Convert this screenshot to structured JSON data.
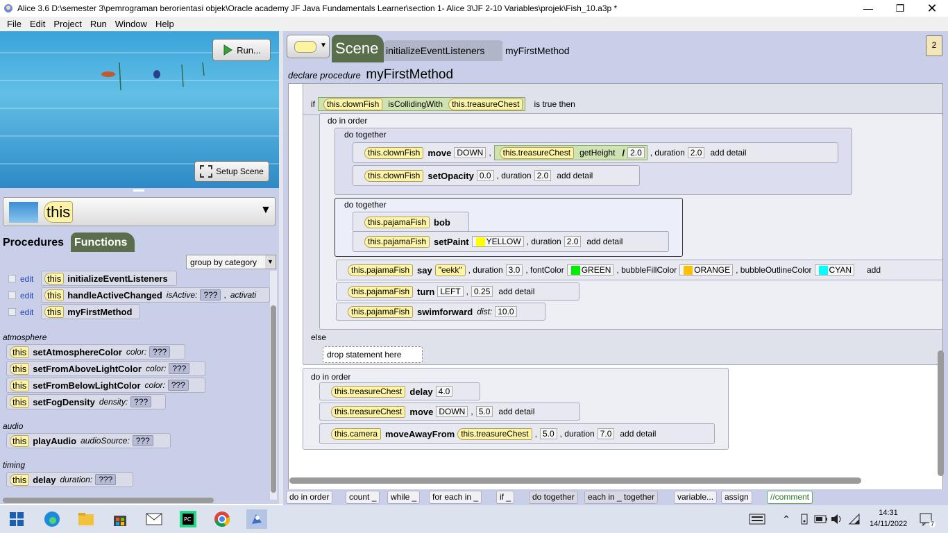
{
  "window": {
    "title": "Alice 3.6 D:\\semester 3\\pemrograman berorientasi objek\\Oracle academy JF Java Fundamentals Learner\\section 1- Alice 3\\JF 2-10 Variables\\projek\\Fish_10.a3p *"
  },
  "menu": [
    "File",
    "Edit",
    "Project",
    "Run",
    "Window",
    "Help"
  ],
  "scene": {
    "run_label": "Run...",
    "setup_label": "Setup Scene"
  },
  "selector": {
    "value": "this"
  },
  "panel_tabs": {
    "procedures": "Procedures",
    "functions": "Functions"
  },
  "group_by": "group by category",
  "methods": [
    {
      "edit": "edit",
      "this": "this",
      "name": "initializeEventListeners",
      "param": "",
      "value": ""
    },
    {
      "edit": "edit",
      "this": "this",
      "name": "handleActiveChanged",
      "param": "isActive:",
      "value": "???",
      "extra": "activati"
    },
    {
      "edit": "edit",
      "this": "this",
      "name": "myFirstMethod",
      "param": "",
      "value": ""
    }
  ],
  "categories": [
    {
      "name": "atmosphere",
      "items": [
        {
          "this": "this",
          "name": "setAtmosphereColor",
          "param": "color:",
          "value": "???"
        },
        {
          "this": "this",
          "name": "setFromAboveLightColor",
          "param": "color:",
          "value": "???"
        },
        {
          "this": "this",
          "name": "setFromBelowLightColor",
          "param": "color:",
          "value": "???"
        },
        {
          "this": "this",
          "name": "setFogDensity",
          "param": "density:",
          "value": "???"
        }
      ]
    },
    {
      "name": "audio",
      "items": [
        {
          "this": "this",
          "name": "playAudio",
          "param": "audioSource:",
          "value": "???"
        }
      ]
    },
    {
      "name": "timing",
      "items": [
        {
          "this": "this",
          "name": "delay",
          "param": "duration:",
          "value": "???"
        }
      ]
    }
  ],
  "editor_tabs": {
    "scene": "Scene",
    "init": "initializeEventListeners",
    "current": "myFirstMethod",
    "clip_count": "2"
  },
  "declare": {
    "prefix": "declare procedure",
    "name": "myFirstMethod"
  },
  "code": {
    "if_kw": "if",
    "clownfish": "this.clownFish",
    "colliding": "isCollidingWith",
    "chest": "this.treasureChest",
    "is_true": "is true then",
    "do_in_order": "do in order",
    "do_together": "do together",
    "move": "move",
    "down": "DOWN",
    "getheight": "getHeight",
    "div": "/",
    "v2": "2.0",
    "duration": ", duration",
    "add_detail": "add detail",
    "setopacity": "setOpacity",
    "v0": "0.0",
    "pajama": "this.pajamaFish",
    "bob": "bob",
    "setpaint": "setPaint",
    "yellow": "YELLOW",
    "say": "say",
    "eekk": "\"eekk\"",
    "v3": "3.0",
    "fontcolor": ", fontColor",
    "green": "GREEN",
    "bubblefill": ", bubbleFillColor",
    "orange": "ORANGE",
    "bubbleoutline": ", bubbleOutlineColor",
    "cyan": "CYAN",
    "add_trunc": "add",
    "turn": "turn",
    "left": "LEFT",
    "v025": "0.25",
    "swim": "swimforward",
    "dist": "dist:",
    "v10": "10.0",
    "else_kw": "else",
    "drop": "drop statement here",
    "delay": "delay",
    "v4": "4.0",
    "v5": "5.0",
    "camera": "this.camera",
    "moveaway": "moveAwayFrom",
    "v7": "7.0"
  },
  "palette": [
    "do in order",
    "count _",
    "while _",
    "for each in _",
    "if _",
    "do together",
    "each in _ together",
    "variable...",
    "assign",
    "//comment"
  ],
  "taskbar": {
    "time": "14:31",
    "date": "14/11/2022",
    "notif": "7"
  },
  "colors": {
    "panel": "#c9cfe8",
    "object_pill": "#fdf4a5",
    "green": "#00ee00",
    "orange": "#ffc000",
    "cyan": "#00ffff",
    "yellow": "#ffff00"
  }
}
